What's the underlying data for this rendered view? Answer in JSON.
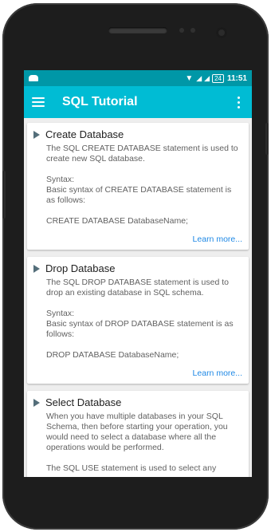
{
  "status": {
    "battery": "24",
    "time": "11:51"
  },
  "appbar": {
    "title": "SQL Tutorial"
  },
  "cards": [
    {
      "title": "Create Database",
      "body": "The SQL CREATE DATABASE statement is used to create new SQL database.\n\nSyntax:\nBasic syntax of CREATE DATABASE statement is as follows:\n\nCREATE DATABASE DatabaseName;",
      "link": "Learn more..."
    },
    {
      "title": "Drop Database",
      "body": "The SQL DROP DATABASE statement is used to drop an existing database in SQL schema.\n\nSyntax:\nBasic syntax of DROP DATABASE statement is as follows:\n\nDROP DATABASE DatabaseName;",
      "link": "Learn more..."
    },
    {
      "title": "Select Database",
      "body": "When you have multiple databases in your SQL Schema, then before starting your operation, you would need to select a database where all the operations would be performed.\n\nThe SQL USE statement is used to select any"
    }
  ],
  "colors": {
    "statusbar": "#0097a7",
    "appbar": "#00bcd4",
    "link": "#1e88e5"
  }
}
